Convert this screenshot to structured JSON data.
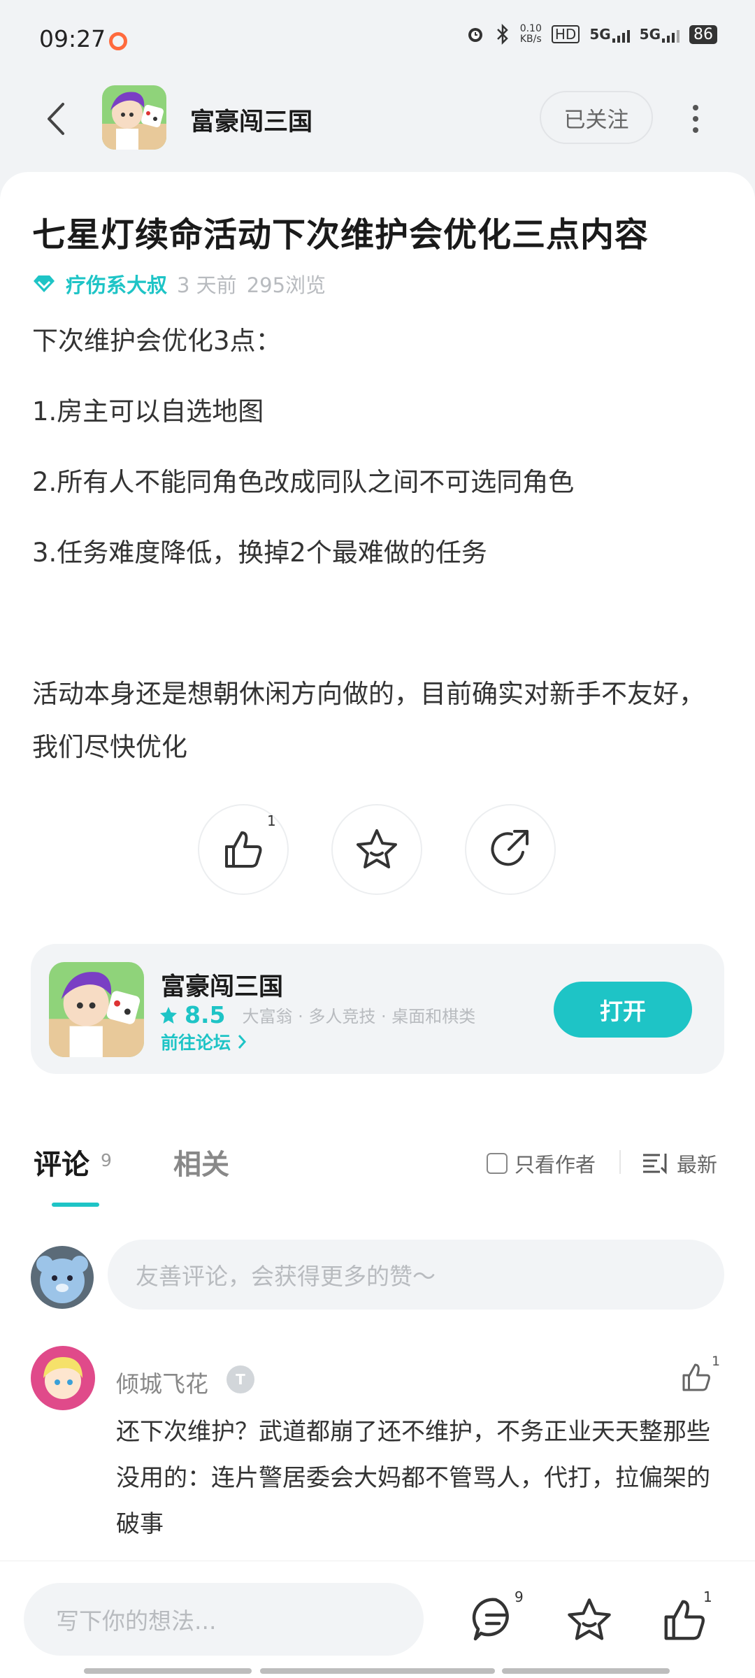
{
  "status_bar": {
    "time": "09:27",
    "net_speed_value": "0.10",
    "net_speed_unit": "KB/s",
    "hd_label": "HD",
    "sig1": "5G",
    "sig2": "5G",
    "battery": "86"
  },
  "header": {
    "game_title": "富豪闯三国",
    "follow_label": "已关注"
  },
  "post": {
    "title": "七星灯续命活动下次维护会优化三点内容",
    "author": "疗伤系大叔",
    "time_ago": "3 天前",
    "views": "295浏览",
    "body": [
      "下次维护会优化3点：",
      "1.房主可以自选地图",
      "2.所有人不能同角色改成同队之间不可选同角色",
      "3.任务难度降低，换掉2个最难做的任务",
      "",
      "活动本身还是想朝休闲方向做的，目前确实对新手不友好，我们尽快优化"
    ],
    "like_count": "1"
  },
  "game_card": {
    "name": "富豪闯三国",
    "score": "8.5",
    "tags": "大富翁 · 多人竞技 · 桌面和棋类",
    "forum_link": "前往论坛",
    "open_label": "打开"
  },
  "comments": {
    "tab_comment": "评论",
    "tab_comment_count": "9",
    "tab_related": "相关",
    "author_only": "只看作者",
    "sort_label": "最新",
    "input_placeholder": "友善评论，会获得更多的赞～",
    "items": [
      {
        "name": "倾城飞花",
        "badge": "T",
        "like_count": "1",
        "text": "还下次维护？武道都崩了还不维护，不务正业天天整那些没用的：连片警居委会大妈都不管骂人，代打，拉偏架的破事"
      }
    ]
  },
  "bottom_bar": {
    "input_placeholder": "写下你的想法...",
    "comment_count": "9",
    "like_count": "1"
  },
  "colors": {
    "accent": "#1ec4c6",
    "background": "#f1f3f5"
  }
}
